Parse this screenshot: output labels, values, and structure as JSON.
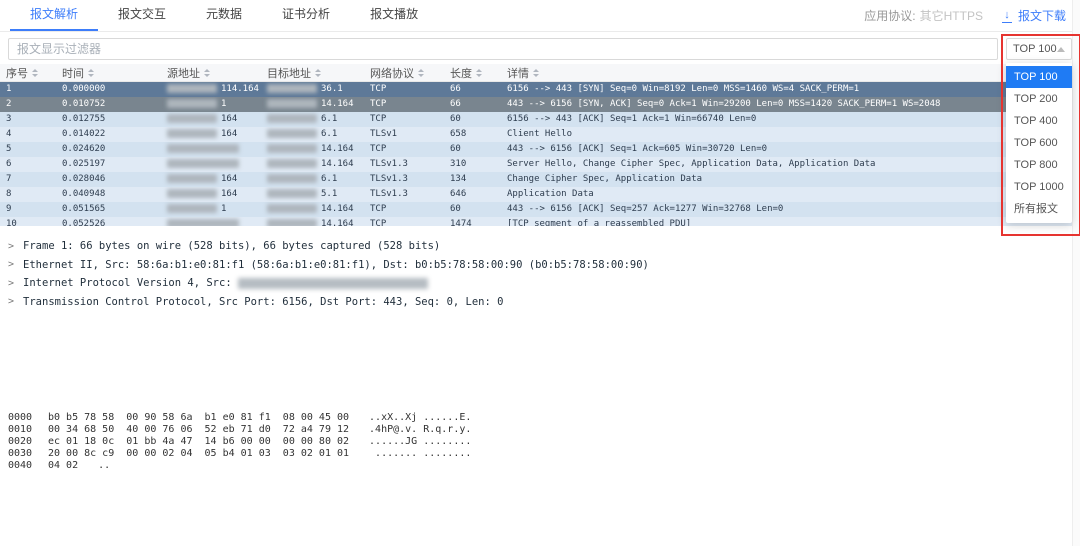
{
  "tabs": [
    {
      "label": "报文解析",
      "active": true
    },
    {
      "label": "报文交互",
      "active": false
    },
    {
      "label": "元数据",
      "active": false
    },
    {
      "label": "证书分析",
      "active": false
    },
    {
      "label": "报文播放",
      "active": false
    }
  ],
  "header_right": {
    "protocol_label": "应用协议:",
    "protocol_value": "其它HTTPS",
    "download_label": "报文下载"
  },
  "filter": {
    "placeholder": "报文显示过滤器"
  },
  "top_select": {
    "value": "TOP 100",
    "selected_index": 0,
    "options": [
      "TOP 100",
      "TOP 200",
      "TOP 400",
      "TOP 600",
      "TOP 800",
      "TOP 1000",
      "所有报文"
    ]
  },
  "table": {
    "columns": [
      "序号",
      "时间",
      "源地址",
      "目标地址",
      "网络协议",
      "长度",
      "详情"
    ],
    "rows": [
      {
        "no": "1",
        "time": "0.000000",
        "src": {
          "redacted": true,
          "visible": "114.164"
        },
        "dst": {
          "redacted": true,
          "visible": "36.1"
        },
        "proto": "TCP",
        "len": "66",
        "info": "6156 --> 443 [SYN] Seq=0 Win=8192 Len=0 MSS=1460 WS=4 SACK_PERM=1",
        "style": "dark"
      },
      {
        "no": "2",
        "time": "0.010752",
        "src": {
          "redacted": true,
          "visible": "1"
        },
        "dst": {
          "redacted": true,
          "visible": "14.164"
        },
        "proto": "TCP",
        "len": "66",
        "info": "443 --> 6156 [SYN, ACK] Seq=0 Ack=1 Win=29200 Len=0 MSS=1420 SACK_PERM=1 WS=2048",
        "style": "gray"
      },
      {
        "no": "3",
        "time": "0.012755",
        "src": {
          "redacted": true,
          "visible": "164"
        },
        "dst": {
          "redacted": true,
          "visible": "6.1"
        },
        "proto": "TCP",
        "len": "60",
        "info": "6156 --> 443 [ACK] Seq=1 Ack=1 Win=66740 Len=0",
        "style": "base"
      },
      {
        "no": "4",
        "time": "0.014022",
        "src": {
          "redacted": true,
          "visible": "164"
        },
        "dst": {
          "redacted": true,
          "visible": "6.1"
        },
        "proto": "TLSv1",
        "len": "658",
        "info": "Client Hello",
        "style": "alt"
      },
      {
        "no": "5",
        "time": "0.024620",
        "src": {
          "redacted": true,
          "visible": ""
        },
        "dst": {
          "redacted": true,
          "visible": "14.164"
        },
        "proto": "TCP",
        "len": "60",
        "info": "443 --> 6156 [ACK] Seq=1 Ack=605 Win=30720 Len=0",
        "style": "base"
      },
      {
        "no": "6",
        "time": "0.025197",
        "src": {
          "redacted": true,
          "visible": ""
        },
        "dst": {
          "redacted": true,
          "visible": "14.164"
        },
        "proto": "TLSv1.3",
        "len": "310",
        "info": "Server Hello, Change Cipher Spec, Application Data, Application Data",
        "style": "alt"
      },
      {
        "no": "7",
        "time": "0.028046",
        "src": {
          "redacted": true,
          "visible": "164"
        },
        "dst": {
          "redacted": true,
          "visible": "6.1"
        },
        "proto": "TLSv1.3",
        "len": "134",
        "info": "Change Cipher Spec, Application Data",
        "style": "base"
      },
      {
        "no": "8",
        "time": "0.040948",
        "src": {
          "redacted": true,
          "visible": "164"
        },
        "dst": {
          "redacted": true,
          "visible": "5.1"
        },
        "proto": "TLSv1.3",
        "len": "646",
        "info": "Application Data",
        "style": "alt"
      },
      {
        "no": "9",
        "time": "0.051565",
        "src": {
          "redacted": true,
          "visible": "1"
        },
        "dst": {
          "redacted": true,
          "visible": "14.164"
        },
        "proto": "TCP",
        "len": "60",
        "info": "443 --> 6156 [ACK] Seq=257 Ack=1277 Win=32768 Len=0",
        "style": "base"
      },
      {
        "no": "10",
        "time": "0.052526",
        "src": {
          "redacted": true,
          "visible": ""
        },
        "dst": {
          "redacted": true,
          "visible": "14.164"
        },
        "proto": "TCP",
        "len": "1474",
        "info": "[TCP segment of a reassembled PDU]",
        "style": "alt"
      }
    ]
  },
  "detail_tree": [
    {
      "text": "Frame 1: 66 bytes on wire (528 bits), 66 bytes captured (528 bits)",
      "redacted": false
    },
    {
      "text": "Ethernet II, Src: 58:6a:b1:e0:81:f1 (58:6a:b1:e0:81:f1), Dst: b0:b5:78:58:00:90 (b0:b5:78:58:00:90)",
      "redacted": false
    },
    {
      "text": "Internet Protocol Version 4, Src:",
      "redacted": true
    },
    {
      "text": "Transmission Control Protocol, Src Port: 6156, Dst Port: 443, Seq: 0, Len: 0",
      "redacted": false
    }
  ],
  "hex_dump": [
    {
      "offset": "0000",
      "hex": "b0 b5 78 58  00 90 58 6a  b1 e0 81 f1  08 00 45 00",
      "ascii": "..xX..Xj ......E."
    },
    {
      "offset": "0010",
      "hex": "00 34 68 50  40 00 76 06  52 eb 71 d0  72 a4 79 12",
      "ascii": ".4hP@.v. R.q.r.y."
    },
    {
      "offset": "0020",
      "hex": "ec 01 18 0c  01 bb 4a 47  14 b6 00 00  00 00 80 02",
      "ascii": "......JG ........"
    },
    {
      "offset": "0030",
      "hex": "20 00 8c c9  00 00 02 04  05 b4 01 03  03 02 01 01",
      "ascii": " ....... ........"
    },
    {
      "offset": "0040",
      "hex": "04 02",
      "ascii": ".."
    }
  ],
  "colors": {
    "accent_blue": "#3d7dfa",
    "annotation_red": "#e63430",
    "selected_row_dark": "#5e7998",
    "selected_row_gray": "#79858f",
    "dropdown_selected": "#1f7bf4"
  }
}
